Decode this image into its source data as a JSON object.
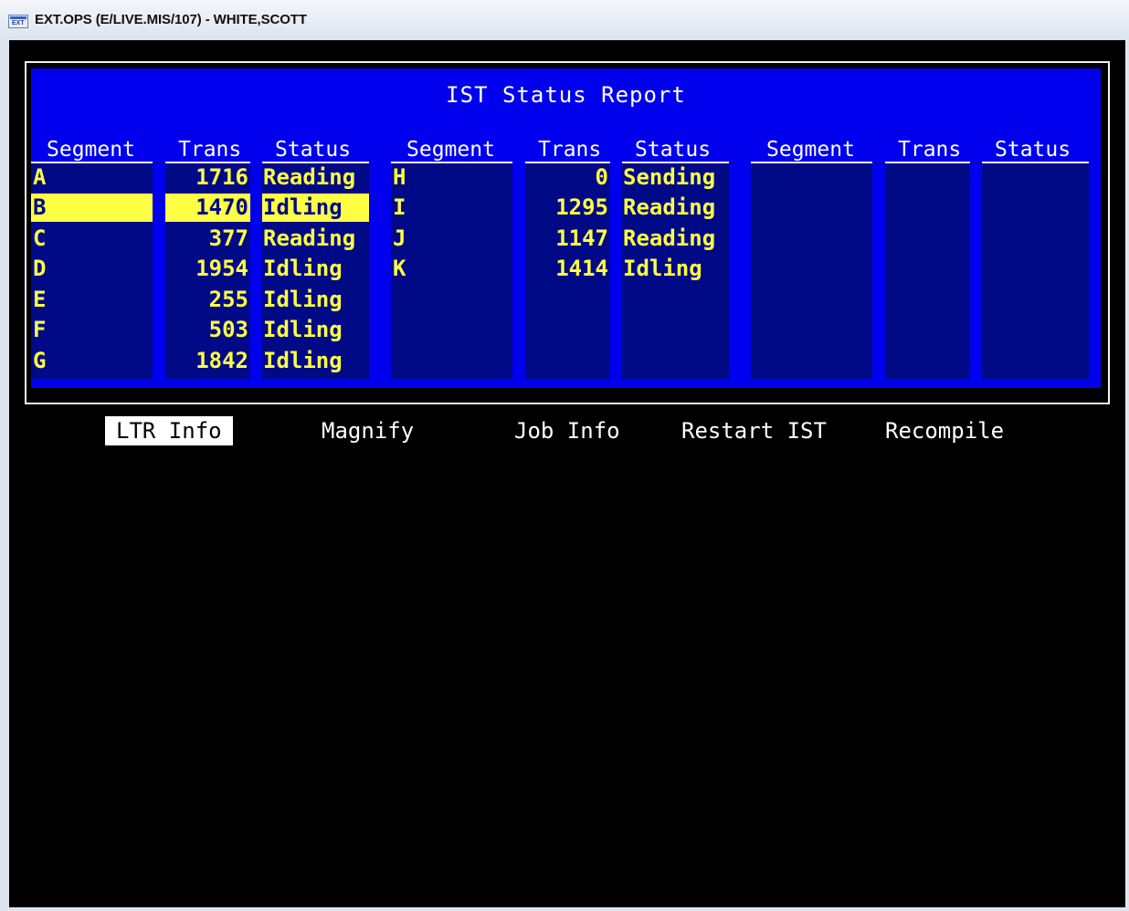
{
  "window": {
    "title": "EXT.OPS (E/LIVE.MIS/107) - WHITE,SCOTT",
    "app_icon": "terminal-icon",
    "icon_text": "EXT"
  },
  "report": {
    "title": "IST Status Report",
    "headers": {
      "segment": "Segment",
      "trans": "Trans",
      "status": "Status"
    },
    "columns": [
      {
        "rows": [
          {
            "segment": "A",
            "trans": "1716",
            "status": "Reading"
          },
          {
            "segment": "B",
            "trans": "1470",
            "status": "Idling",
            "selected": true
          },
          {
            "segment": "C",
            "trans": "377",
            "status": "Reading"
          },
          {
            "segment": "D",
            "trans": "1954",
            "status": "Idling"
          },
          {
            "segment": "E",
            "trans": "255",
            "status": "Idling"
          },
          {
            "segment": "F",
            "trans": "503",
            "status": "Idling"
          },
          {
            "segment": "G",
            "trans": "1842",
            "status": "Idling"
          }
        ]
      },
      {
        "rows": [
          {
            "segment": "H",
            "trans": "0",
            "status": "Sending"
          },
          {
            "segment": "I",
            "trans": "1295",
            "status": "Reading"
          },
          {
            "segment": "J",
            "trans": "1147",
            "status": "Reading"
          },
          {
            "segment": "K",
            "trans": "1414",
            "status": "Idling"
          }
        ]
      },
      {
        "rows": []
      }
    ]
  },
  "menu": {
    "items": [
      {
        "label": "LTR Info",
        "active": true
      },
      {
        "label": "Magnify"
      },
      {
        "label": "Job Info"
      },
      {
        "label": "Restart IST"
      },
      {
        "label": "Recompile"
      }
    ]
  },
  "colors": {
    "panel": "#0000ee",
    "column_bg": "#000a86",
    "value_text": "#ffff44",
    "selection": "#ffff44",
    "terminal_bg": "#000000"
  }
}
